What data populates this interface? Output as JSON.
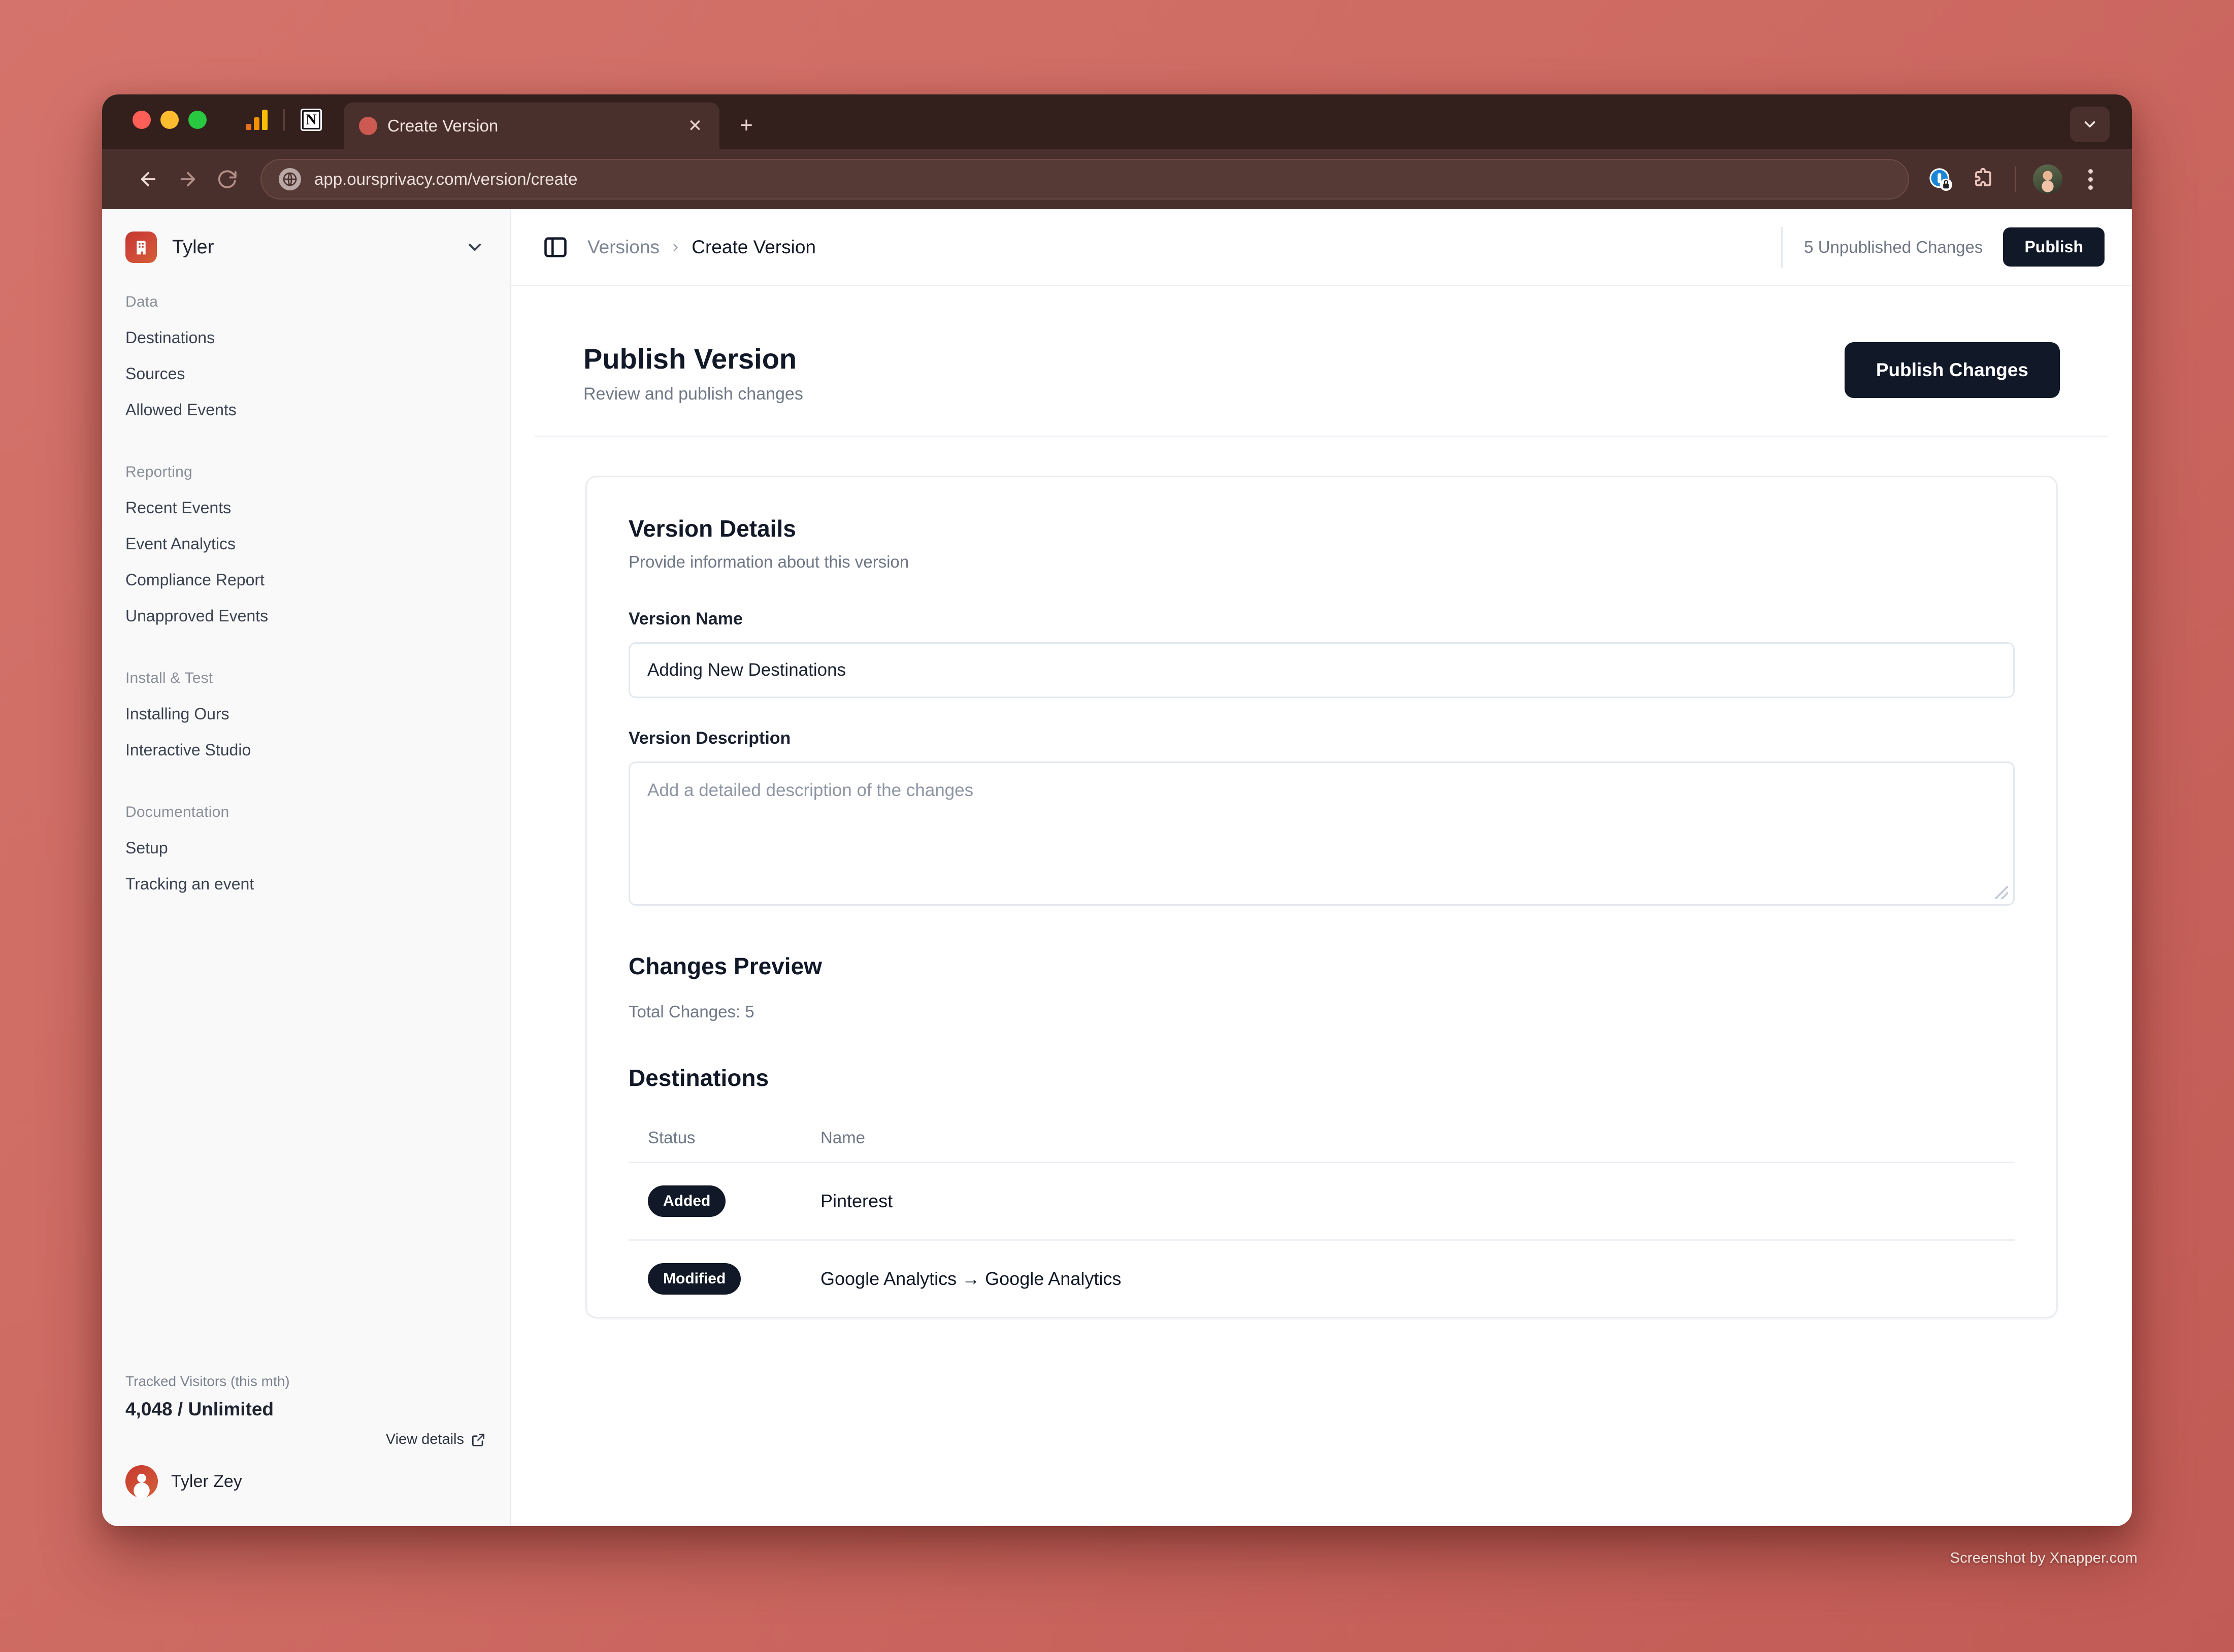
{
  "browser": {
    "tab": {
      "title": "Create Version",
      "close_label": "✕"
    },
    "new_tab_label": "+",
    "pinned_tabs": [
      {
        "name": "google-analytics",
        "label": "Google Analytics"
      },
      {
        "name": "notion",
        "label": "N"
      }
    ],
    "url": "app.oursprivacy.com/version/create",
    "nav": {
      "back": "back",
      "forward": "forward",
      "reload": "reload"
    }
  },
  "sidebar": {
    "org": {
      "name": "Tyler"
    },
    "groups": [
      {
        "label": "Data",
        "items": [
          {
            "label": "Destinations",
            "key": "destinations"
          },
          {
            "label": "Sources",
            "key": "sources"
          },
          {
            "label": "Allowed Events",
            "key": "allowed-events"
          }
        ]
      },
      {
        "label": "Reporting",
        "items": [
          {
            "label": "Recent Events",
            "key": "recent-events"
          },
          {
            "label": "Event Analytics",
            "key": "event-analytics"
          },
          {
            "label": "Compliance Report",
            "key": "compliance-report"
          },
          {
            "label": "Unapproved Events",
            "key": "unapproved-events"
          }
        ]
      },
      {
        "label": "Install & Test",
        "items": [
          {
            "label": "Installing Ours",
            "key": "installing-ours"
          },
          {
            "label": "Interactive Studio",
            "key": "interactive-studio"
          }
        ]
      },
      {
        "label": "Documentation",
        "items": [
          {
            "label": "Setup",
            "key": "setup"
          },
          {
            "label": "Tracking an event",
            "key": "tracking-an-event"
          }
        ]
      }
    ],
    "usage": {
      "label": "Tracked Visitors (this mth)",
      "used": "4,048",
      "separator": " / ",
      "limit": "Unlimited",
      "view_details": "View details"
    },
    "user": {
      "name": "Tyler Zey"
    }
  },
  "topbar": {
    "breadcrumb_parent": "Versions",
    "breadcrumb_separator": "›",
    "breadcrumb_current": "Create Version",
    "unpublished_changes": "5 Unpublished Changes",
    "publish_label": "Publish"
  },
  "page": {
    "title": "Publish Version",
    "subtitle": "Review and publish changes",
    "publish_changes_label": "Publish Changes"
  },
  "version_details": {
    "title": "Version Details",
    "subtitle": "Provide information about this version",
    "name_label": "Version Name",
    "name_value": "Adding New Destinations",
    "description_label": "Version Description",
    "description_value": "",
    "description_placeholder": "Add a detailed description of the changes"
  },
  "changes_preview": {
    "title": "Changes Preview",
    "total_changes": "Total Changes: 5",
    "destinations_title": "Destinations",
    "columns": {
      "status": "Status",
      "name": "Name"
    },
    "rows": [
      {
        "status": "Added",
        "name": "Pinterest"
      },
      {
        "status": "Modified",
        "name": "Google Analytics → Google Analytics"
      }
    ]
  },
  "watermark": "Screenshot by Xnapper.com",
  "colors": {
    "accent_dark": "#111827",
    "brand_red": "#cd5a52",
    "sidebar_bg": "#f9f9fa",
    "desktop_bg": "#cd6a62"
  }
}
